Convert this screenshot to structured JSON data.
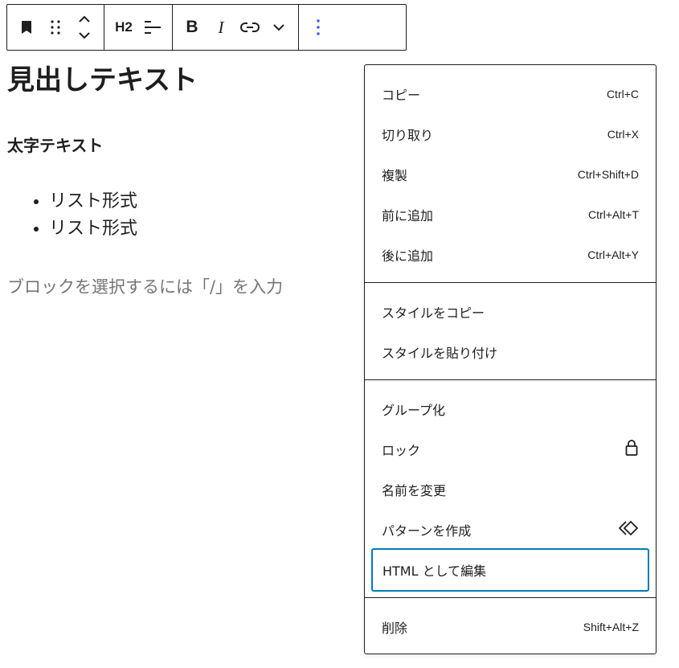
{
  "toolbar": {
    "heading_level": "H2"
  },
  "content": {
    "heading": "見出しテキスト",
    "bold_paragraph": "太字テキスト",
    "list_items": [
      "リスト形式",
      "リスト形式"
    ],
    "placeholder": "ブロックを選択するには「/」を入力"
  },
  "menu": {
    "copy": {
      "label": "コピー",
      "shortcut": "Ctrl+C"
    },
    "cut": {
      "label": "切り取り",
      "shortcut": "Ctrl+X"
    },
    "duplicate": {
      "label": "複製",
      "shortcut": "Ctrl+Shift+D"
    },
    "insert_before": {
      "label": "前に追加",
      "shortcut": "Ctrl+Alt+T"
    },
    "insert_after": {
      "label": "後に追加",
      "shortcut": "Ctrl+Alt+Y"
    },
    "copy_styles": {
      "label": "スタイルをコピー"
    },
    "paste_styles": {
      "label": "スタイルを貼り付け"
    },
    "group": {
      "label": "グループ化"
    },
    "lock": {
      "label": "ロック",
      "icon": "lock-icon"
    },
    "rename": {
      "label": "名前を変更"
    },
    "create_pattern": {
      "label": "パターンを作成",
      "icon": "pattern-icon"
    },
    "edit_html": {
      "label": "HTML として編集"
    },
    "delete": {
      "label": "削除",
      "shortcut": "Shift+Alt+Z"
    }
  },
  "colors": {
    "accent": "#3858e9",
    "focus": "#007cba",
    "text": "#1e1e1e",
    "placeholder": "#757575"
  }
}
